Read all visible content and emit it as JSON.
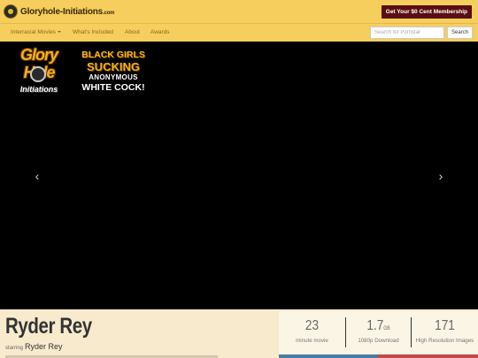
{
  "header": {
    "logo_text": "Gloryhole-Initiations",
    "logo_suffix": ".com",
    "join_label": "Get Your $0 Cent Membership"
  },
  "nav": {
    "items": [
      {
        "label": "Interracial Movies"
      },
      {
        "label": "What's Included"
      },
      {
        "label": "About"
      },
      {
        "label": "Awards"
      }
    ],
    "search_placeholder": "Search for Pornstar",
    "search_label": "Search"
  },
  "hero": {
    "logo_line1": "Glory",
    "logo_line2": "Hole",
    "logo_line3": "Initiations",
    "tagline": [
      "BLACK GIRLS",
      "SUCKING",
      "ANONYMOUS",
      "WHITE COCK!"
    ],
    "prev_icon": "chevron-left-icon",
    "next_icon": "chevron-right-icon"
  },
  "model": {
    "name": "Ryder Rey",
    "starring_label": "starring",
    "starring_name": "Ryder Rey"
  },
  "stats": [
    {
      "value": "23",
      "unit": "",
      "label": "minute movie"
    },
    {
      "value": "1.7",
      "unit": "GB",
      "label": "1080p Download"
    },
    {
      "value": "171",
      "unit": "",
      "label": "High Resolution Images"
    }
  ],
  "colors": {
    "header_bg": "#f5ce5e",
    "join_bg": "#5a0e12",
    "info_bg": "#f8ebcd",
    "strip_blue": "#4a7ba7",
    "strip_red": "#c04a45"
  }
}
